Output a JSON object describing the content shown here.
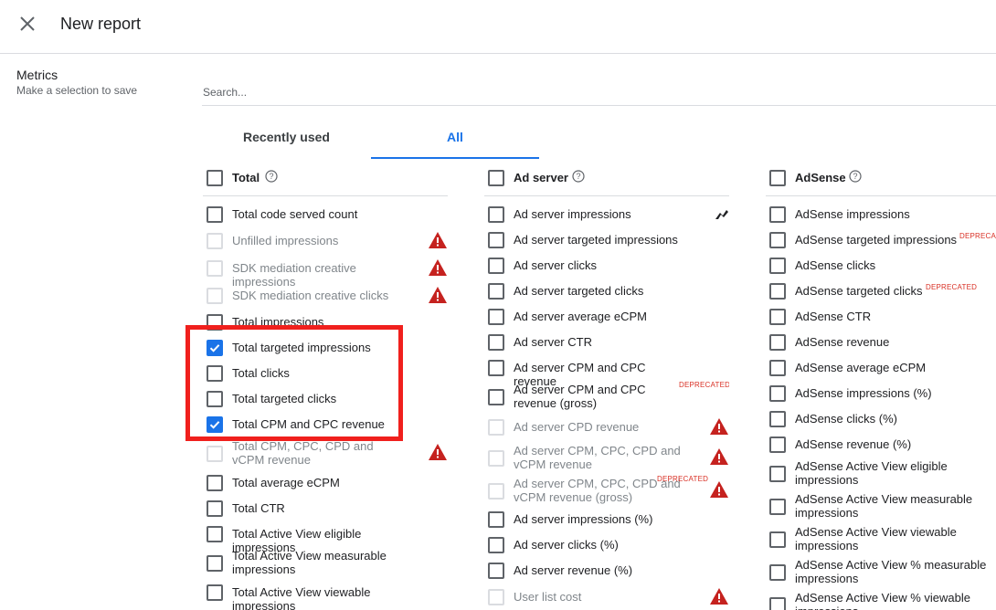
{
  "header": {
    "title": "New report"
  },
  "sidebar": {
    "title": "Metrics",
    "subtitle": "Make a selection to save"
  },
  "search": {
    "placeholder": "Search..."
  },
  "tabs": [
    {
      "label": "Recently used",
      "active": false
    },
    {
      "label": "All",
      "active": true
    }
  ],
  "columns": [
    {
      "title": "Total",
      "items": [
        {
          "label": "Total code served count",
          "checked": false,
          "disabled": false,
          "warning": false
        },
        {
          "label": "Unfilled impressions",
          "checked": false,
          "disabled": true,
          "warning": true
        },
        {
          "label": "SDK mediation creative impressions",
          "checked": false,
          "disabled": true,
          "warning": true
        },
        {
          "label": "SDK mediation creative clicks",
          "checked": false,
          "disabled": true,
          "warning": true
        },
        {
          "label": "Total impressions",
          "checked": false,
          "disabled": false,
          "warning": false
        },
        {
          "label": "Total targeted impressions",
          "checked": true,
          "disabled": false,
          "warning": false
        },
        {
          "label": "Total clicks",
          "checked": false,
          "disabled": false,
          "warning": false
        },
        {
          "label": "Total targeted clicks",
          "checked": false,
          "disabled": false,
          "warning": false
        },
        {
          "label": "Total CPM and CPC revenue",
          "checked": true,
          "disabled": false,
          "warning": false
        },
        {
          "label": "Total CPM, CPC, CPD and vCPM revenue",
          "checked": false,
          "disabled": true,
          "warning": true
        },
        {
          "label": "Total average eCPM",
          "checked": false,
          "disabled": false,
          "warning": false
        },
        {
          "label": "Total CTR",
          "checked": false,
          "disabled": false,
          "warning": false
        },
        {
          "label": "Total Active View eligible impressions",
          "checked": false,
          "disabled": false,
          "warning": false
        },
        {
          "label": "Total Active View measurable impressions",
          "checked": false,
          "disabled": false,
          "warning": false
        },
        {
          "label": "Total Active View viewable impressions",
          "checked": false,
          "disabled": false,
          "warning": false
        }
      ]
    },
    {
      "title": "Ad server",
      "items": [
        {
          "label": "Ad server impressions",
          "checked": false,
          "disabled": false,
          "warning": false
        },
        {
          "label": "Ad server targeted impressions",
          "checked": false,
          "disabled": false,
          "warning": false
        },
        {
          "label": "Ad server clicks",
          "checked": false,
          "disabled": false,
          "warning": false
        },
        {
          "label": "Ad server targeted clicks",
          "checked": false,
          "disabled": false,
          "warning": false
        },
        {
          "label": "Ad server average eCPM",
          "checked": false,
          "disabled": false,
          "warning": false
        },
        {
          "label": "Ad server CTR",
          "checked": false,
          "disabled": false,
          "warning": false
        },
        {
          "label": "Ad server CPM and CPC revenue",
          "checked": false,
          "disabled": false,
          "warning": false
        },
        {
          "label": "Ad server CPM and CPC revenue (gross)",
          "checked": false,
          "disabled": false,
          "warning": false,
          "deprecated": "DEPRECATED"
        },
        {
          "label": "Ad server CPD revenue",
          "checked": false,
          "disabled": true,
          "warning": true
        },
        {
          "label": "Ad server CPM, CPC, CPD and vCPM revenue",
          "checked": false,
          "disabled": true,
          "warning": true
        },
        {
          "label": "Ad server CPM, CPC, CPD and vCPM revenue (gross)",
          "checked": false,
          "disabled": true,
          "warning": true,
          "deprecated": "DEPRECATED"
        },
        {
          "label": "Ad server impressions (%)",
          "checked": false,
          "disabled": false,
          "warning": false
        },
        {
          "label": "Ad server clicks (%)",
          "checked": false,
          "disabled": false,
          "warning": false
        },
        {
          "label": "Ad server revenue (%)",
          "checked": false,
          "disabled": false,
          "warning": false
        },
        {
          "label": "User list cost",
          "checked": false,
          "disabled": true,
          "warning": true
        }
      ]
    },
    {
      "title": "AdSense",
      "items": [
        {
          "label": "AdSense impressions",
          "checked": false,
          "disabled": false,
          "warning": false
        },
        {
          "label": "AdSense targeted impressions",
          "checked": false,
          "disabled": false,
          "warning": false,
          "deprecated": "DEPRECA"
        },
        {
          "label": "AdSense clicks",
          "checked": false,
          "disabled": false,
          "warning": false
        },
        {
          "label": "AdSense targeted clicks",
          "checked": false,
          "disabled": false,
          "warning": false,
          "deprecated": "DEPRECATED"
        },
        {
          "label": "AdSense CTR",
          "checked": false,
          "disabled": false,
          "warning": false
        },
        {
          "label": "AdSense revenue",
          "checked": false,
          "disabled": false,
          "warning": false
        },
        {
          "label": "AdSense average eCPM",
          "checked": false,
          "disabled": false,
          "warning": false
        },
        {
          "label": "AdSense impressions (%)",
          "checked": false,
          "disabled": false,
          "warning": false
        },
        {
          "label": "AdSense clicks (%)",
          "checked": false,
          "disabled": false,
          "warning": false
        },
        {
          "label": "AdSense revenue (%)",
          "checked": false,
          "disabled": false,
          "warning": false
        },
        {
          "label": "AdSense Active View eligible impressions",
          "checked": false,
          "disabled": false,
          "warning": false
        },
        {
          "label": "AdSense Active View measurable impressions",
          "checked": false,
          "disabled": false,
          "warning": false
        },
        {
          "label": "AdSense Active View viewable impressions",
          "checked": false,
          "disabled": false,
          "warning": false
        },
        {
          "label": "AdSense Active View % measurable impressions",
          "checked": false,
          "disabled": false,
          "warning": false
        },
        {
          "label": "AdSense Active View % viewable impressions",
          "checked": false,
          "disabled": false,
          "warning": false
        }
      ]
    }
  ],
  "colors": {
    "accent": "#1a73e8",
    "warning": "#c5221f",
    "highlight": "#f0201d",
    "deprecated": "#d93025"
  },
  "icons": {
    "close": "close-icon",
    "help": "help-icon",
    "warning": "warning-icon"
  }
}
